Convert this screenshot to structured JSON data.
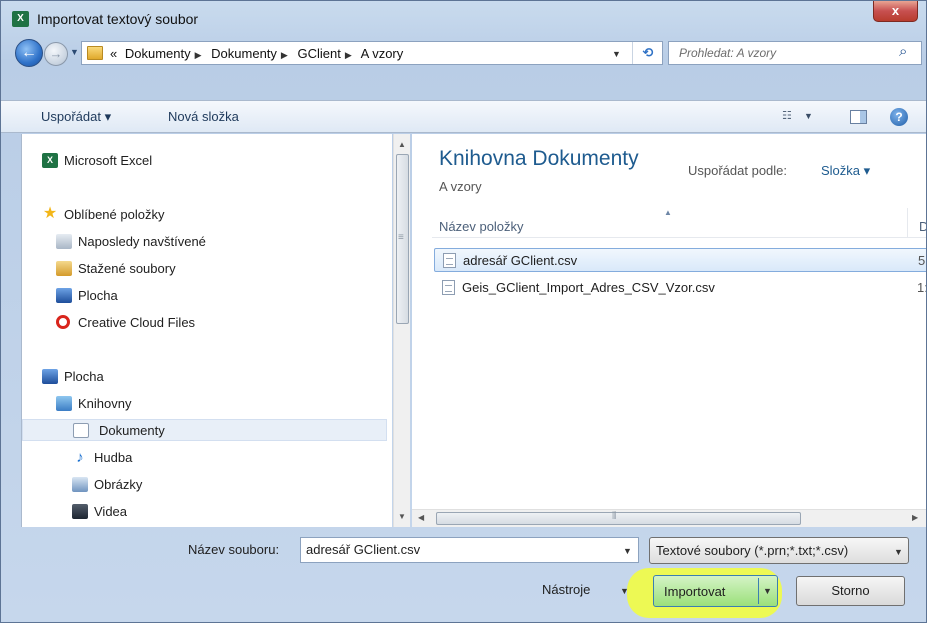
{
  "window": {
    "title": "Importovat textový soubor",
    "close_symbol": "x"
  },
  "address": {
    "overflow": "«",
    "crumbs": [
      "Dokumenty",
      "Dokumenty",
      "GClient",
      "A vzory"
    ],
    "search_placeholder": "Prohledat: A vzory"
  },
  "toolbar": {
    "organize": "Uspořádat ▾",
    "new_folder": "Nová složka",
    "help": "?"
  },
  "nav": {
    "items": [
      {
        "label": "Microsoft Excel",
        "icon": "excel-icon"
      },
      {
        "label": "Oblíbené položky",
        "icon": "star-icon"
      },
      {
        "label": "Naposledy navštívené",
        "icon": "recent-places-icon"
      },
      {
        "label": "Stažené soubory",
        "icon": "downloads-icon"
      },
      {
        "label": "Plocha",
        "icon": "desktop-icon"
      },
      {
        "label": "Creative Cloud Files",
        "icon": "creative-cloud-icon"
      },
      {
        "label": "Plocha",
        "icon": "desktop-icon"
      },
      {
        "label": "Knihovny",
        "icon": "libraries-icon"
      },
      {
        "label": "Dokumenty",
        "icon": "document-icon"
      },
      {
        "label": "Hudba",
        "icon": "music-icon"
      },
      {
        "label": "Obrázky",
        "icon": "pictures-icon"
      },
      {
        "label": "Videa",
        "icon": "videos-icon"
      }
    ],
    "selected": "Dokumenty"
  },
  "content": {
    "library_title": "Knihovna Dokumenty",
    "library_subtitle": "A vzory",
    "arrange_label": "Uspořádat podle:",
    "arrange_value": "Složka ▾",
    "column_name": "Název položky",
    "column_date": "D",
    "files": [
      {
        "name": "adresář GClient.csv",
        "date": "5",
        "selected": true
      },
      {
        "name": "Geis_GClient_Import_Adres_CSV_Vzor.csv",
        "date": "1:",
        "selected": false
      }
    ]
  },
  "bottom": {
    "filename_label": "Název souboru:",
    "filename_value": "adresář GClient.csv",
    "filter": "Textové soubory (*.prn;*.txt;*.csv)",
    "tools": "Nástroje",
    "import": "Importovat",
    "cancel": "Storno"
  },
  "colors": {
    "highlight": "#f3ff3a",
    "import_button": "#9be07a",
    "library_title": "#1e5b8f"
  }
}
